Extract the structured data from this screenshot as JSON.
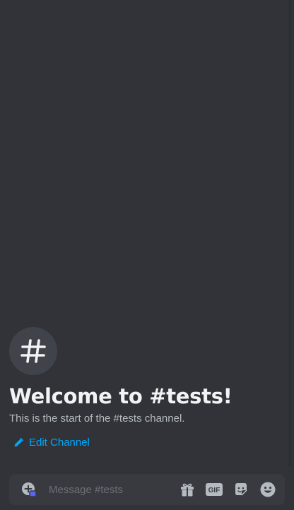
{
  "channel": {
    "name": "#tests",
    "avatar_glyph": "#",
    "welcome_title": "Welcome to #tests!",
    "description": "This is the start of the #tests channel.",
    "edit_label": "Edit Channel"
  },
  "composer": {
    "placeholder": "Message #tests",
    "value": "",
    "buttons": {
      "gift_icon": "gift-icon",
      "gif_label": "GIF",
      "sticker_icon": "sticker-icon",
      "emoji_icon": "emoji-icon"
    }
  },
  "colors": {
    "background": "#313338",
    "composer_background": "#383a40",
    "title": "#f2f3f5",
    "description": "#b5bac1",
    "link": "#00a8fc",
    "placeholder": "#6d6f78",
    "icon": "#b5bac1",
    "attach_accent": "#5865f2"
  }
}
